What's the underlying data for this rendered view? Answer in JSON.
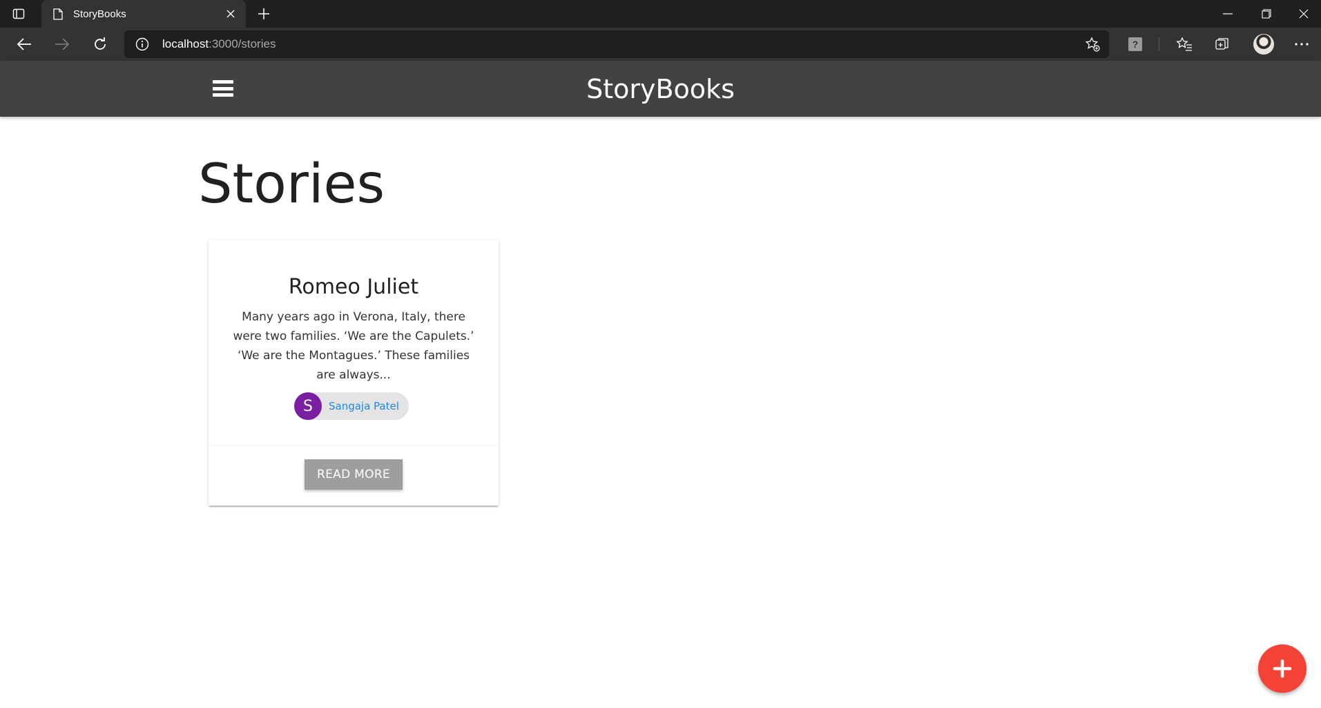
{
  "browser": {
    "tab_title": "StoryBooks",
    "url_host": "localhost",
    "url_rest": ":3000/stories"
  },
  "app": {
    "brand": "StoryBooks",
    "page_title": "Stories"
  },
  "stories": [
    {
      "title": "Romeo Juliet",
      "excerpt": "Many years ago in Verona, Italy, there were two families. ‘We are the Capulets.’ ‘We are the Montagues.’ These families are always...",
      "author_initial": "S",
      "author_name": "Sangaja Patel",
      "button_label": "READ MORE"
    }
  ],
  "colors": {
    "nav_bg": "#424242",
    "avatar_bg": "#7b1fa2",
    "author_link": "#1e88e5",
    "button_bg": "#9e9e9e",
    "fab_bg": "#f44336"
  },
  "icons": {
    "menu": "hamburger-icon",
    "add": "plus-icon"
  }
}
